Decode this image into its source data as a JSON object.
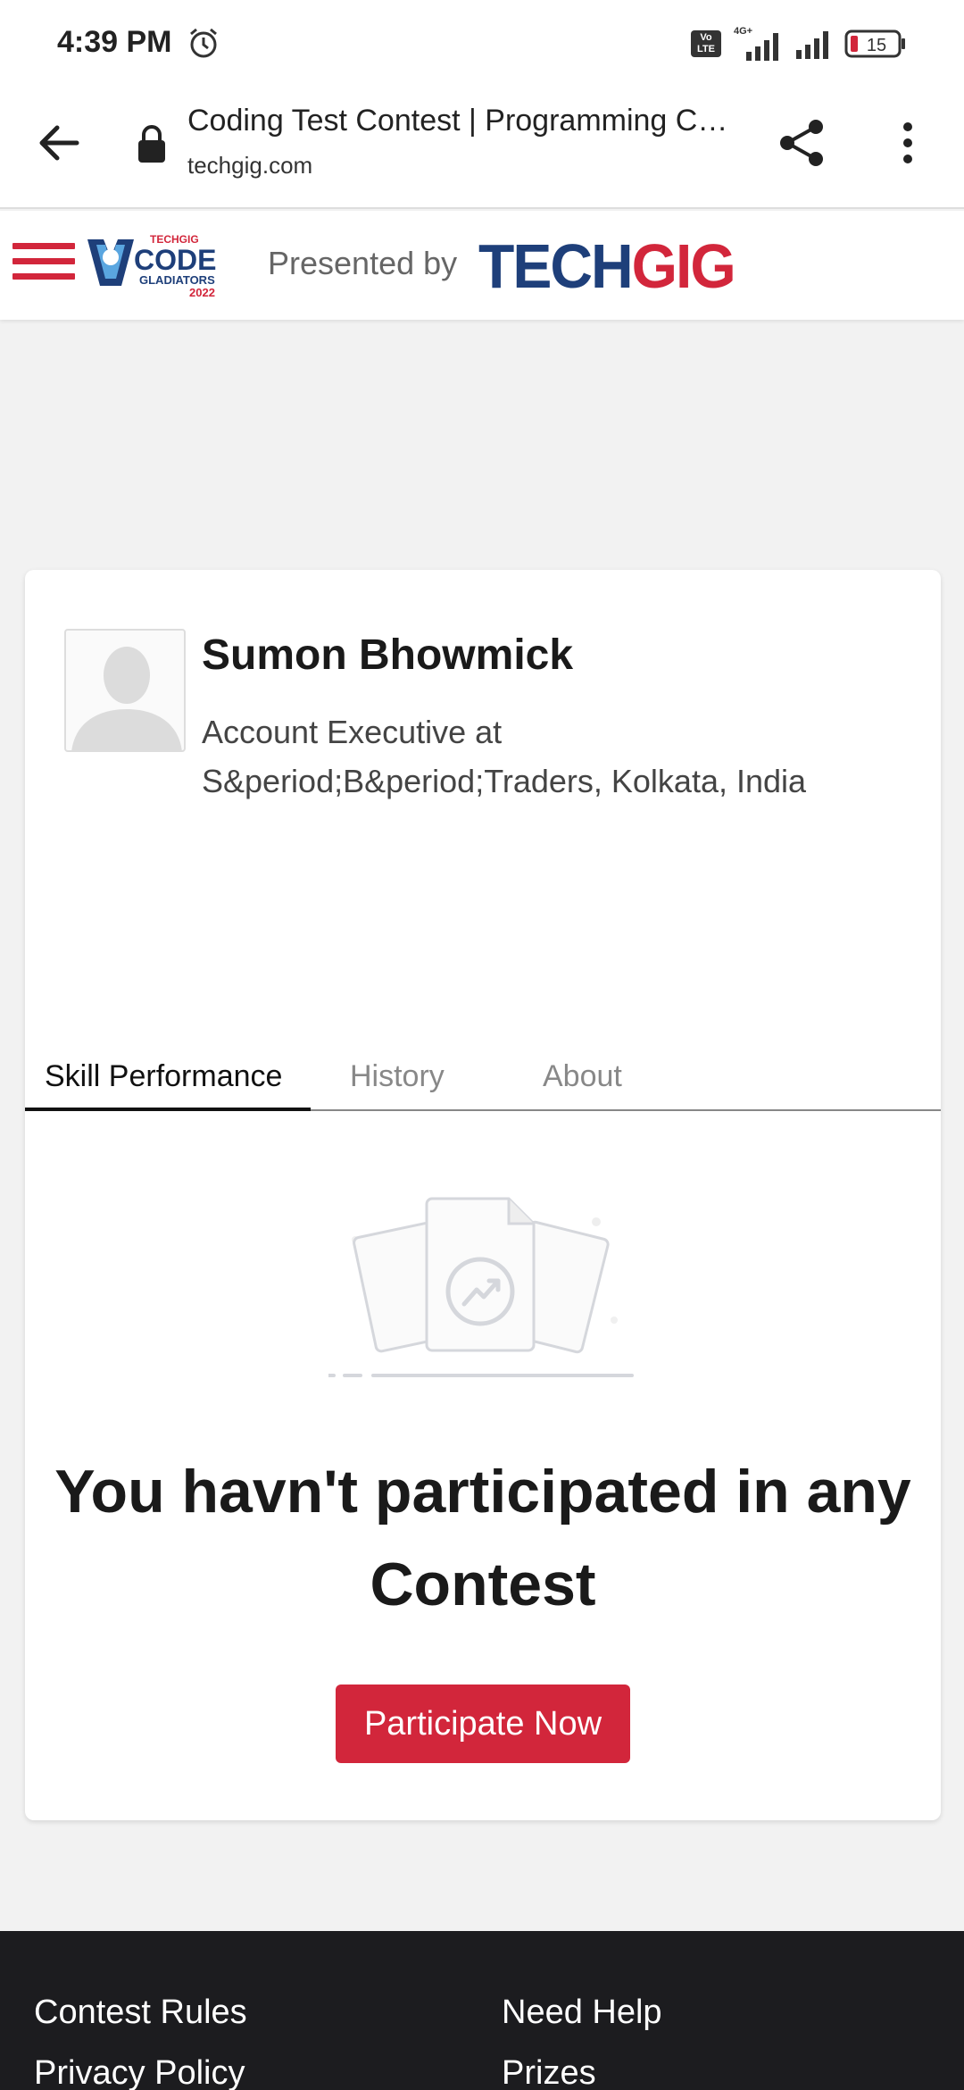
{
  "status_bar": {
    "time": "4:39 PM",
    "network_label": "Vo\nLTE",
    "signal_label": "4G+",
    "battery_level": "15",
    "icons": [
      "alarm-icon",
      "volte-icon",
      "signal-icon",
      "signal-icon",
      "battery-icon"
    ]
  },
  "browser": {
    "title": "Coding Test Contest | Programming Contest | TechGig",
    "url": "techgig.com",
    "icons": [
      "back-arrow-icon",
      "lock-icon",
      "share-icon",
      "more-vertical-icon"
    ]
  },
  "site_header": {
    "presented_by": "Presented by",
    "brand_tech": "TECH",
    "brand_gig": "GIG",
    "logo_small": "TECHGIG",
    "logo_main": "CODE",
    "logo_sub": "GLADIATORS",
    "logo_year": "2022",
    "colors": {
      "red": "#d2263b",
      "navy": "#1e3f7a"
    }
  },
  "profile": {
    "name": "Sumon Bhowmick",
    "role_line1": "Account Executive at",
    "role_line2": "S&period;B&period;Traders, Kolkata, India"
  },
  "tabs": [
    {
      "label": "Skill Performance",
      "active": true
    },
    {
      "label": "History",
      "active": false
    },
    {
      "label": "About",
      "active": false
    }
  ],
  "empty_state": {
    "line1": "You havn't participated in any",
    "line2": "Contest",
    "button": "Participate Now",
    "icon": "trending-document-icon"
  },
  "footer": {
    "links": [
      "Contest Rules",
      "Need Help",
      "Privacy Policy",
      "Prizes"
    ]
  }
}
